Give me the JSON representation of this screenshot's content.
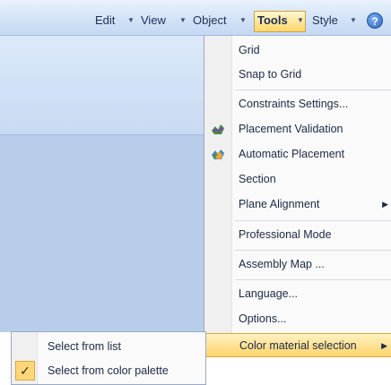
{
  "menubar": {
    "items": [
      {
        "label": "Edit"
      },
      {
        "label": "View"
      },
      {
        "label": "Object"
      },
      {
        "label": "Tools"
      },
      {
        "label": "Style"
      }
    ],
    "help_icon": "?"
  },
  "tools_menu": {
    "items": [
      {
        "label": "Grid"
      },
      {
        "label": "Snap to Grid"
      },
      {
        "label": "Constraints Settings..."
      },
      {
        "label": "Placement Validation",
        "icon": "placement-validation-icon"
      },
      {
        "label": "Automatic Placement",
        "icon": "automatic-placement-icon"
      },
      {
        "label": "Section"
      },
      {
        "label": "Plane Alignment",
        "submenu": true
      },
      {
        "label": "Professional Mode"
      },
      {
        "label": "Assembly Map ..."
      },
      {
        "label": "Language..."
      },
      {
        "label": "Options..."
      },
      {
        "label": "Color material selection",
        "submenu": true,
        "highlighted": true
      }
    ]
  },
  "color_submenu": {
    "items": [
      {
        "label": "Select from list",
        "checked": false
      },
      {
        "label": "Select from color palette",
        "checked": true
      }
    ]
  },
  "colors": {
    "highlight": "#ffd36b",
    "menubar": "#d3e3f7",
    "pane": "#b8cdea"
  }
}
